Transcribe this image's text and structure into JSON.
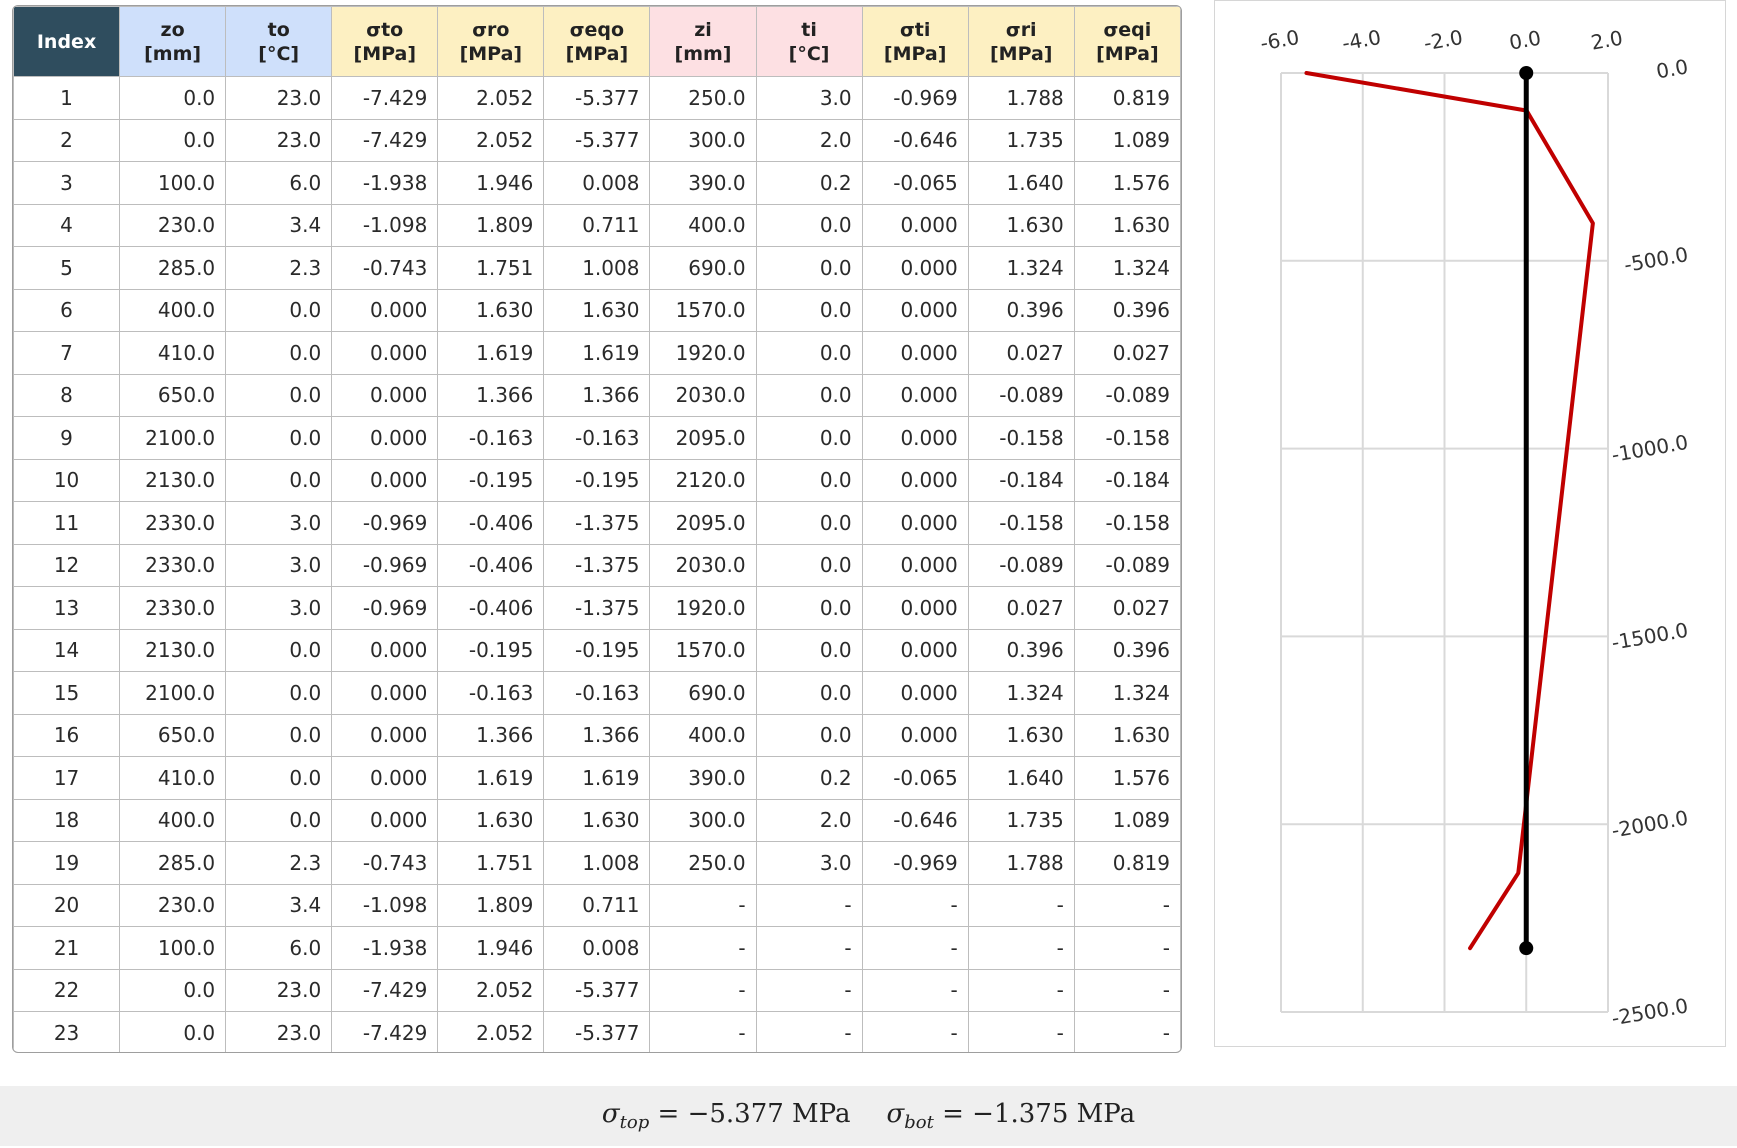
{
  "table": {
    "headers": [
      {
        "name": "Index",
        "unit": "",
        "group": "index"
      },
      {
        "name": "zo",
        "unit": "[mm]",
        "group": "blue"
      },
      {
        "name": "to",
        "unit": "[°C]",
        "group": "blue"
      },
      {
        "name": "σto",
        "unit": "[MPa]",
        "group": "yellow"
      },
      {
        "name": "σro",
        "unit": "[MPa]",
        "group": "yellow"
      },
      {
        "name": "σeqo",
        "unit": "[MPa]",
        "group": "yellow"
      },
      {
        "name": "zi",
        "unit": "[mm]",
        "group": "pink"
      },
      {
        "name": "ti",
        "unit": "[°C]",
        "group": "pink"
      },
      {
        "name": "σti",
        "unit": "[MPa]",
        "group": "yellow"
      },
      {
        "name": "σri",
        "unit": "[MPa]",
        "group": "yellow"
      },
      {
        "name": "σeqi",
        "unit": "[MPa]",
        "group": "yellow"
      }
    ],
    "rows": [
      [
        "1",
        "0.0",
        "23.0",
        "-7.429",
        "2.052",
        "-5.377",
        "250.0",
        "3.0",
        "-0.969",
        "1.788",
        "0.819"
      ],
      [
        "2",
        "0.0",
        "23.0",
        "-7.429",
        "2.052",
        "-5.377",
        "300.0",
        "2.0",
        "-0.646",
        "1.735",
        "1.089"
      ],
      [
        "3",
        "100.0",
        "6.0",
        "-1.938",
        "1.946",
        "0.008",
        "390.0",
        "0.2",
        "-0.065",
        "1.640",
        "1.576"
      ],
      [
        "4",
        "230.0",
        "3.4",
        "-1.098",
        "1.809",
        "0.711",
        "400.0",
        "0.0",
        "0.000",
        "1.630",
        "1.630"
      ],
      [
        "5",
        "285.0",
        "2.3",
        "-0.743",
        "1.751",
        "1.008",
        "690.0",
        "0.0",
        "0.000",
        "1.324",
        "1.324"
      ],
      [
        "6",
        "400.0",
        "0.0",
        "0.000",
        "1.630",
        "1.630",
        "1570.0",
        "0.0",
        "0.000",
        "0.396",
        "0.396"
      ],
      [
        "7",
        "410.0",
        "0.0",
        "0.000",
        "1.619",
        "1.619",
        "1920.0",
        "0.0",
        "0.000",
        "0.027",
        "0.027"
      ],
      [
        "8",
        "650.0",
        "0.0",
        "0.000",
        "1.366",
        "1.366",
        "2030.0",
        "0.0",
        "0.000",
        "-0.089",
        "-0.089"
      ],
      [
        "9",
        "2100.0",
        "0.0",
        "0.000",
        "-0.163",
        "-0.163",
        "2095.0",
        "0.0",
        "0.000",
        "-0.158",
        "-0.158"
      ],
      [
        "10",
        "2130.0",
        "0.0",
        "0.000",
        "-0.195",
        "-0.195",
        "2120.0",
        "0.0",
        "0.000",
        "-0.184",
        "-0.184"
      ],
      [
        "11",
        "2330.0",
        "3.0",
        "-0.969",
        "-0.406",
        "-1.375",
        "2095.0",
        "0.0",
        "0.000",
        "-0.158",
        "-0.158"
      ],
      [
        "12",
        "2330.0",
        "3.0",
        "-0.969",
        "-0.406",
        "-1.375",
        "2030.0",
        "0.0",
        "0.000",
        "-0.089",
        "-0.089"
      ],
      [
        "13",
        "2330.0",
        "3.0",
        "-0.969",
        "-0.406",
        "-1.375",
        "1920.0",
        "0.0",
        "0.000",
        "0.027",
        "0.027"
      ],
      [
        "14",
        "2130.0",
        "0.0",
        "0.000",
        "-0.195",
        "-0.195",
        "1570.0",
        "0.0",
        "0.000",
        "0.396",
        "0.396"
      ],
      [
        "15",
        "2100.0",
        "0.0",
        "0.000",
        "-0.163",
        "-0.163",
        "690.0",
        "0.0",
        "0.000",
        "1.324",
        "1.324"
      ],
      [
        "16",
        "650.0",
        "0.0",
        "0.000",
        "1.366",
        "1.366",
        "400.0",
        "0.0",
        "0.000",
        "1.630",
        "1.630"
      ],
      [
        "17",
        "410.0",
        "0.0",
        "0.000",
        "1.619",
        "1.619",
        "390.0",
        "0.2",
        "-0.065",
        "1.640",
        "1.576"
      ],
      [
        "18",
        "400.0",
        "0.0",
        "0.000",
        "1.630",
        "1.630",
        "300.0",
        "2.0",
        "-0.646",
        "1.735",
        "1.089"
      ],
      [
        "19",
        "285.0",
        "2.3",
        "-0.743",
        "1.751",
        "1.008",
        "250.0",
        "3.0",
        "-0.969",
        "1.788",
        "0.819"
      ],
      [
        "20",
        "230.0",
        "3.4",
        "-1.098",
        "1.809",
        "0.711",
        "-",
        "-",
        "-",
        "-",
        "-"
      ],
      [
        "21",
        "100.0",
        "6.0",
        "-1.938",
        "1.946",
        "0.008",
        "-",
        "-",
        "-",
        "-",
        "-"
      ],
      [
        "22",
        "0.0",
        "23.0",
        "-7.429",
        "2.052",
        "-5.377",
        "-",
        "-",
        "-",
        "-",
        "-"
      ],
      [
        "23",
        "0.0",
        "23.0",
        "-7.429",
        "2.052",
        "-5.377",
        "-",
        "-",
        "-",
        "-",
        "-"
      ]
    ]
  },
  "chart_data": {
    "type": "line",
    "x_tick_labels": [
      "-6.0",
      "-4.0",
      "-2.0",
      "0.0",
      "2.0"
    ],
    "y_tick_labels": [
      "0.0",
      "-500.0",
      "-1000.0",
      "-1500.0",
      "-2000.0",
      "-2500.0"
    ],
    "x_ticks": [
      -6.0,
      -4.0,
      -2.0,
      0.0,
      2.0
    ],
    "y_ticks": [
      0,
      -500,
      -1000,
      -1500,
      -2000,
      -2500
    ],
    "xlim": [
      -6.0,
      2.0
    ],
    "ylim": [
      -2500,
      0
    ],
    "grid": true,
    "series": [
      {
        "color": "#c00000",
        "points": [
          [
            -5.377,
            0
          ],
          [
            0.008,
            -100
          ],
          [
            0.711,
            -230
          ],
          [
            1.008,
            -285
          ],
          [
            1.63,
            -400
          ],
          [
            1.619,
            -410
          ],
          [
            1.366,
            -650
          ],
          [
            -0.163,
            -2100
          ],
          [
            -0.195,
            -2130
          ],
          [
            -1.375,
            -2330
          ]
        ]
      },
      {
        "color": "#000000",
        "points": [
          [
            0.0,
            0
          ],
          [
            0.0,
            -2330
          ]
        ],
        "markers": true
      }
    ]
  },
  "formula": {
    "sigma_sym": "σ",
    "top_sub": "top",
    "top_value": "= −5.377 MPa",
    "bot_sub": "bot",
    "bot_value": "= −1.375 MPa"
  }
}
